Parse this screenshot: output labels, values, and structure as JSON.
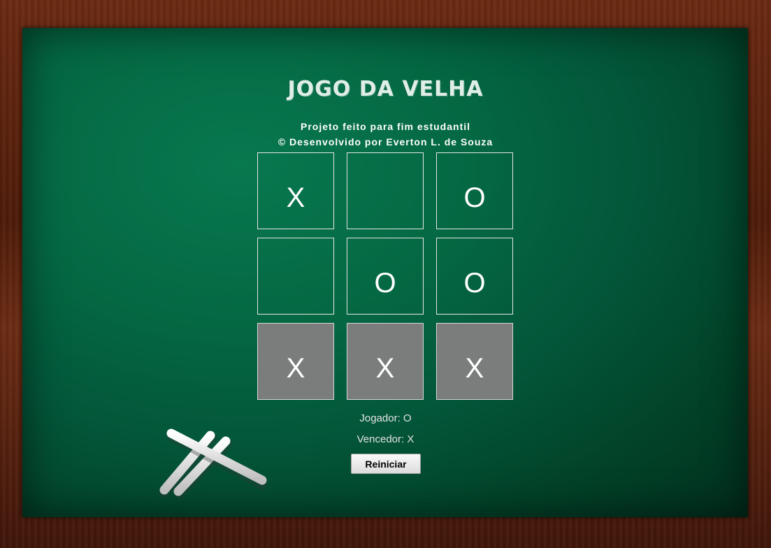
{
  "header": {
    "title": "JOGO DA VELHA",
    "subtitle_line1": "Projeto feito para fim estudantil",
    "subtitle_line2": "© Desenvolvido por Everton L. de Souza"
  },
  "board": {
    "cells": [
      "X",
      "",
      "O",
      "",
      "O",
      "O",
      "X",
      "X",
      "X"
    ],
    "winning_line": [
      6,
      7,
      8
    ],
    "highlight_color": "#7a7d7c"
  },
  "status": {
    "player_text": "Jogador: O",
    "winner_text": "Vencedor: X"
  },
  "controls": {
    "restart_label": "Reiniciar"
  },
  "theme": {
    "chalkboard_color": "#046843",
    "frame_color": "#5a2410"
  },
  "decor": {
    "chalk_icon": "chalk-sticks-icon"
  }
}
